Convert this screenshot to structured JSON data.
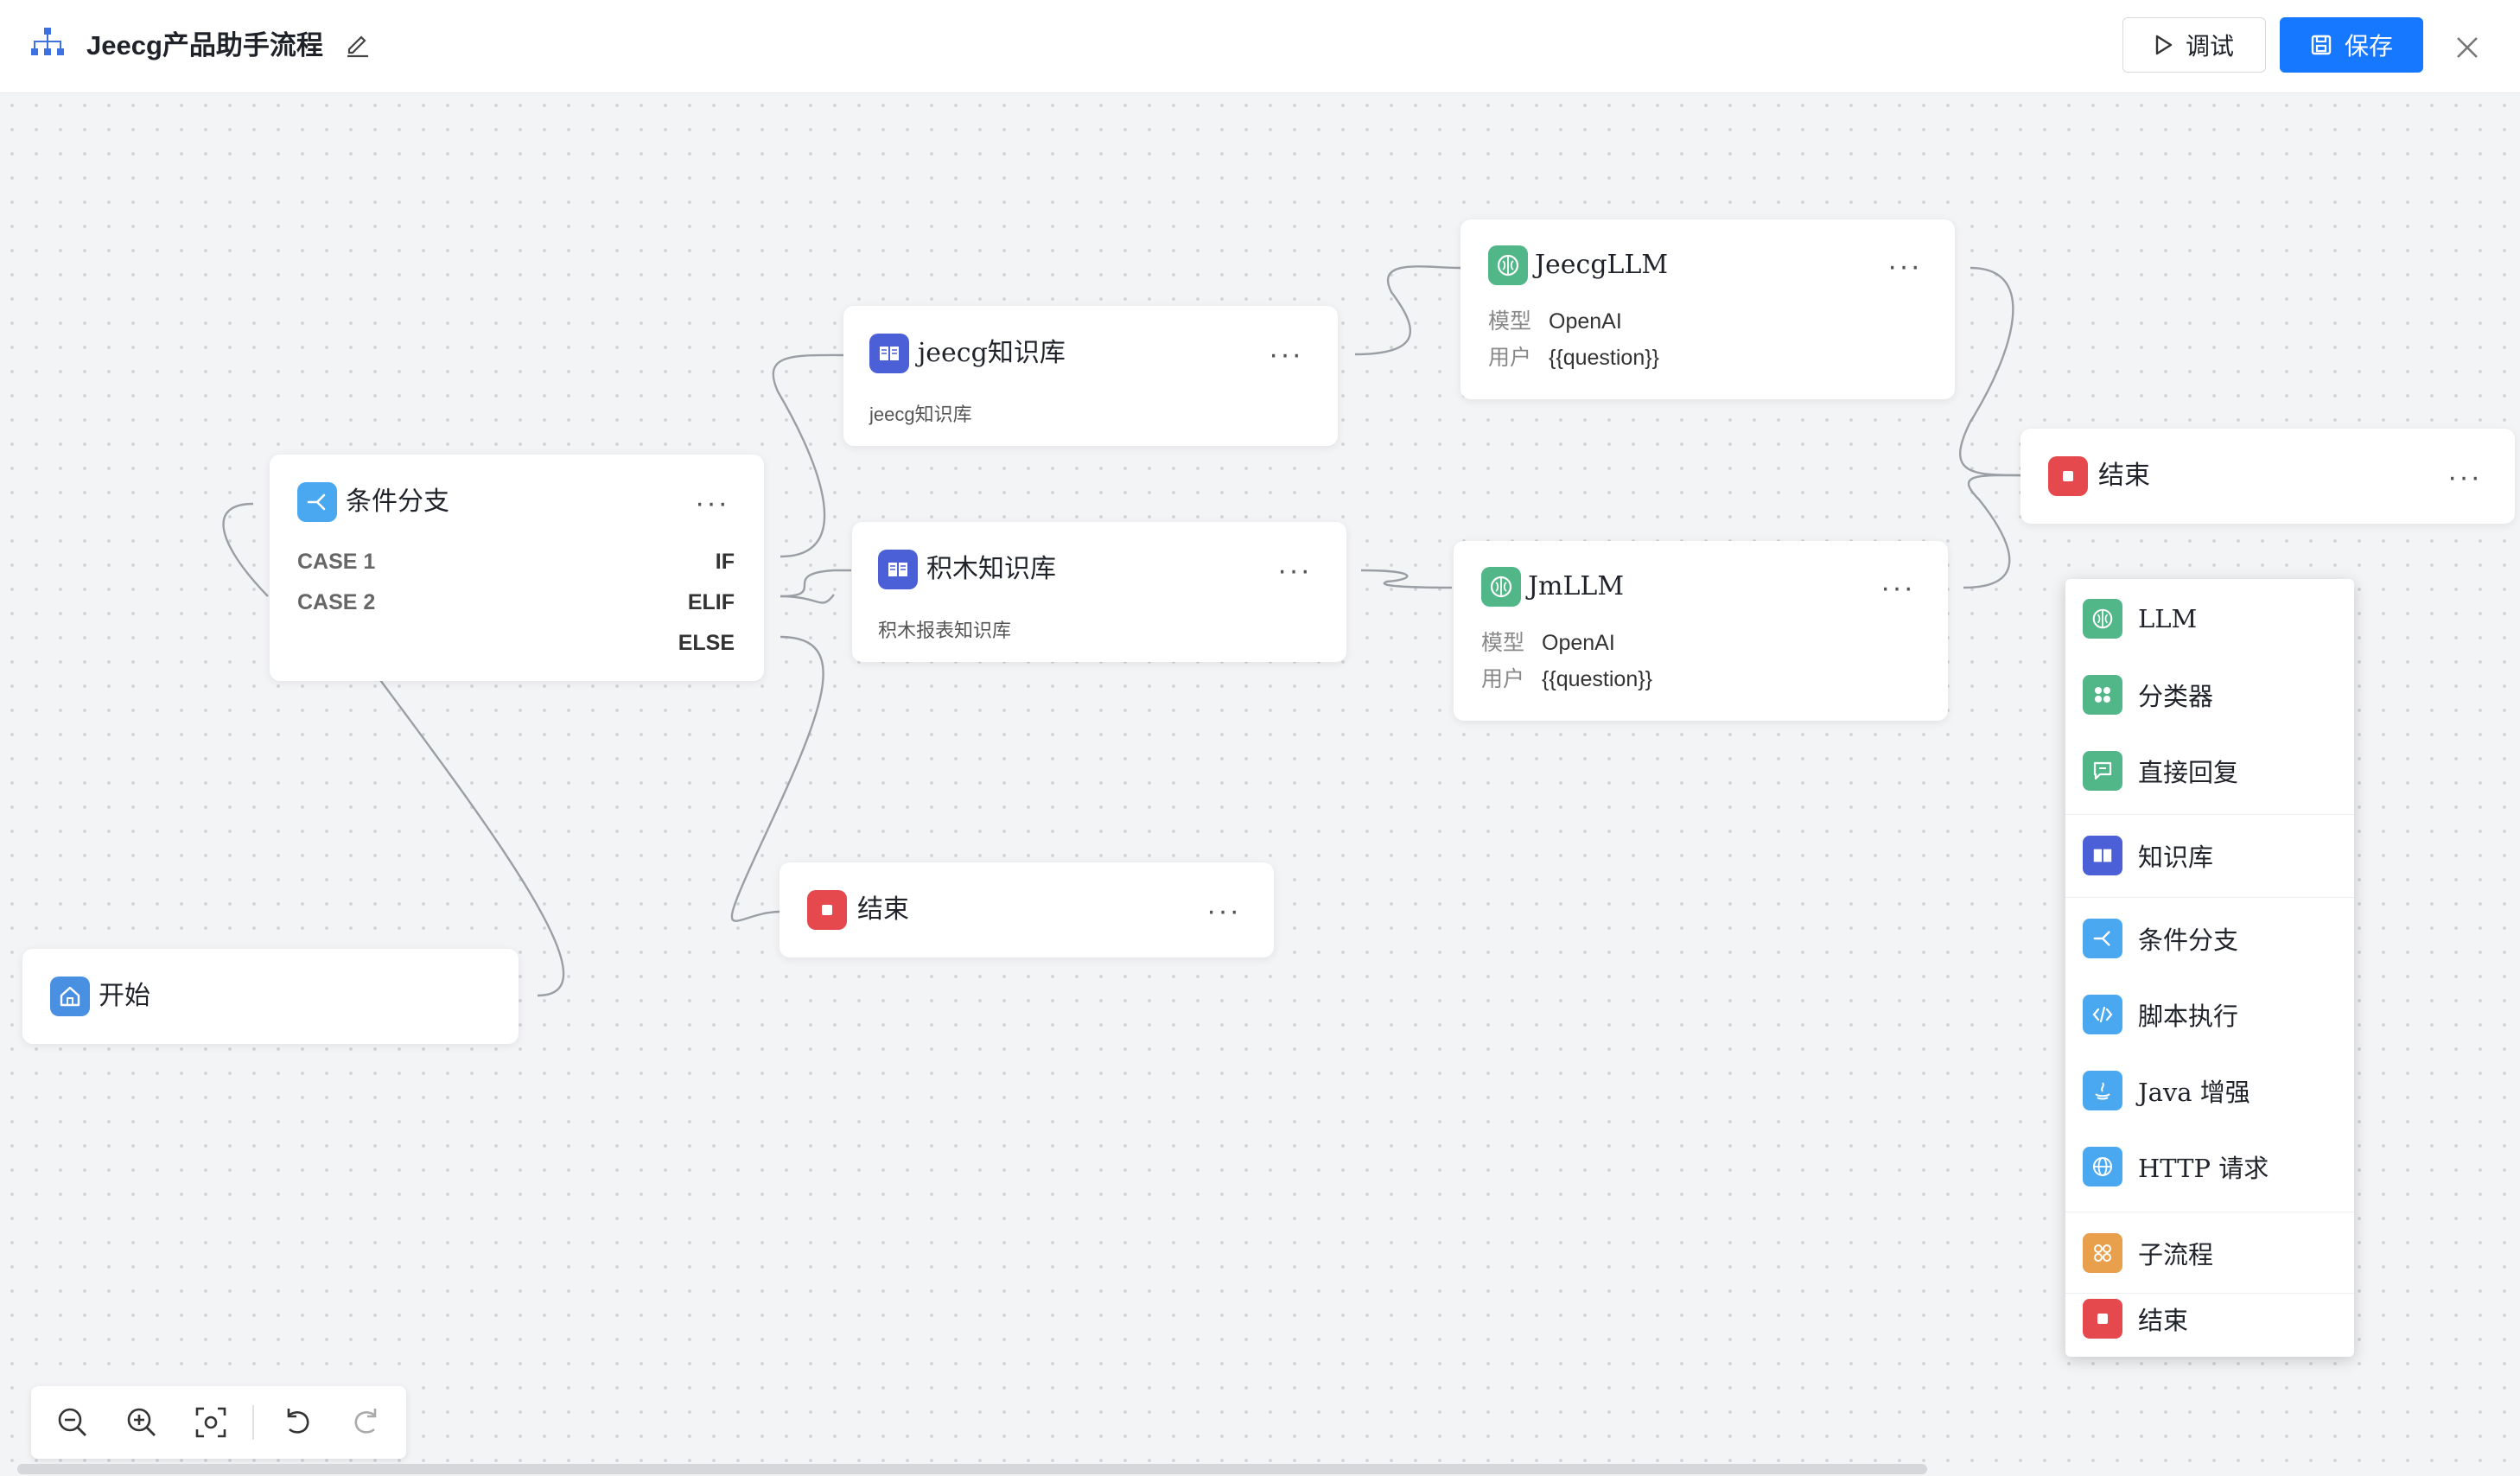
{
  "header": {
    "title": "Jeecg产品助手流程",
    "debug_label": "调试",
    "save_label": "保存"
  },
  "colors": {
    "primary": "#1677ff",
    "knowledge": "#4b5fd6",
    "llm": "#52b788",
    "end": "#e5484d",
    "branch": "#4aa8f0",
    "start": "#4a90e2",
    "subflow": "#e8a04c"
  },
  "nodes": {
    "start": {
      "title": "开始"
    },
    "branch": {
      "title": "条件分支",
      "cases": [
        {
          "label": "CASE 1",
          "branch": "IF"
        },
        {
          "label": "CASE 2",
          "branch": "ELIF"
        },
        {
          "label": "",
          "branch": "ELSE"
        }
      ]
    },
    "kb1": {
      "title": "jeecg知识库",
      "desc": "jeecg知识库"
    },
    "kb2": {
      "title": "积木知识库",
      "desc": "积木报表知识库"
    },
    "llm1": {
      "title": "JeecgLLM",
      "model_key": "模型",
      "model_val": "OpenAI",
      "user_key": "用户",
      "user_val": "{{question}}"
    },
    "llm2": {
      "title": "JmLLM",
      "model_key": "模型",
      "model_val": "OpenAI",
      "user_key": "用户",
      "user_val": "{{question}}"
    },
    "end_top": {
      "title": "结束"
    },
    "end_mid": {
      "title": "结束"
    },
    "more": "···"
  },
  "palette": [
    {
      "label": "LLM",
      "icon": "brain-icon"
    },
    {
      "label": "分类器",
      "icon": "classifier-icon"
    },
    {
      "label": "直接回复",
      "icon": "reply-icon"
    },
    {
      "label": "知识库",
      "icon": "book-icon"
    },
    {
      "label": "条件分支",
      "icon": "branch-icon"
    },
    {
      "label": "脚本执行",
      "icon": "code-icon"
    },
    {
      "label": "Java 增强",
      "icon": "java-icon"
    },
    {
      "label": "HTTP 请求",
      "icon": "globe-icon"
    },
    {
      "label": "子流程",
      "icon": "subflow-icon"
    },
    {
      "label": "结束",
      "icon": "stop-icon"
    }
  ]
}
